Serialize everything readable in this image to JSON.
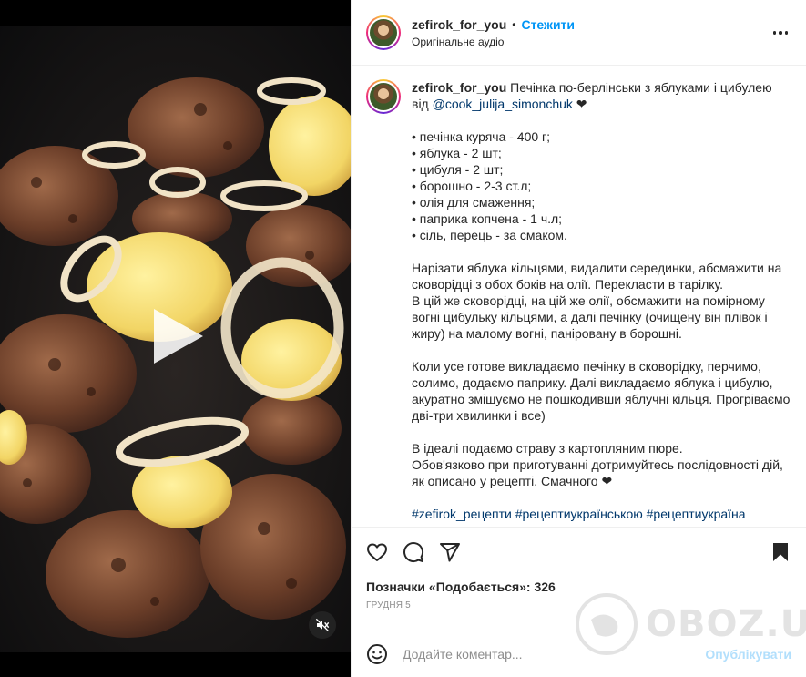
{
  "post": {
    "username": "zefirok_for_you",
    "separator": "•",
    "follow_label": "Стежити",
    "audio_label": "Оригінальне аудіо"
  },
  "caption": {
    "username": "zefirok_for_you",
    "title_text": "Печінка по-берлінськи з яблуками і цибулею від",
    "mention": "@cook_julija_simonchuk",
    "heart": "❤",
    "ingredients": [
      "• печінка куряча - 400 г;",
      "• яблука - 2 шт;",
      "• цибуля - 2 шт;",
      "• борошно - 2-3 ст.л;",
      "• олія для смаження;",
      "• паприка копчена - 1 ч.л;",
      "• сіль, перець - за смаком."
    ],
    "steps": [
      "Нарізати яблука кільцями, видалити серединки, абсмажити на сковорідці з обох боків на олії. Перекласти в тарілку.",
      "В цій же сковорідці, на цій же олії, обсмажити на помірному вогні цибульку кільцями, а далі печінку (очищену він плівок і жиру) на малому вогні, паніровану в борошні."
    ],
    "finish": "Коли усе готове викладаємо печінку в сковорідку, перчимо, солимо, додаємо паприку. Далі викладаємо яблука і цибулю, акуратно змішуємо не пошкодивши яблучні кільця. Прогріваємо дві-три хвилинки і все)",
    "serve": [
      "В ідеалі подаємо страву з картопляним пюре.",
      "Обов'язково при приготуванні дотримуйтесь послідовності дій, як описано у рецепті. Смачного ❤"
    ],
    "hashtags": "#zefirok_рецепти #рецептиукраїнською #рецептиукраїна"
  },
  "actions": {
    "like_icon": "heart-icon",
    "comment_icon": "comment-icon",
    "share_icon": "share-icon",
    "save_icon": "bookmark-icon"
  },
  "likes": {
    "text": "Позначки «Подобається»: 326"
  },
  "date": "грудня 5",
  "comment": {
    "placeholder": "Додайте коментар...",
    "publish_label": "Опублікувати"
  },
  "media": {
    "play_icon": "play-icon",
    "mute_icon": "mute-icon"
  },
  "watermark": "OBOZ.UA",
  "colors": {
    "accent": "#0095f6",
    "link": "#00376b",
    "publish_disabled": "#b2dffc"
  }
}
